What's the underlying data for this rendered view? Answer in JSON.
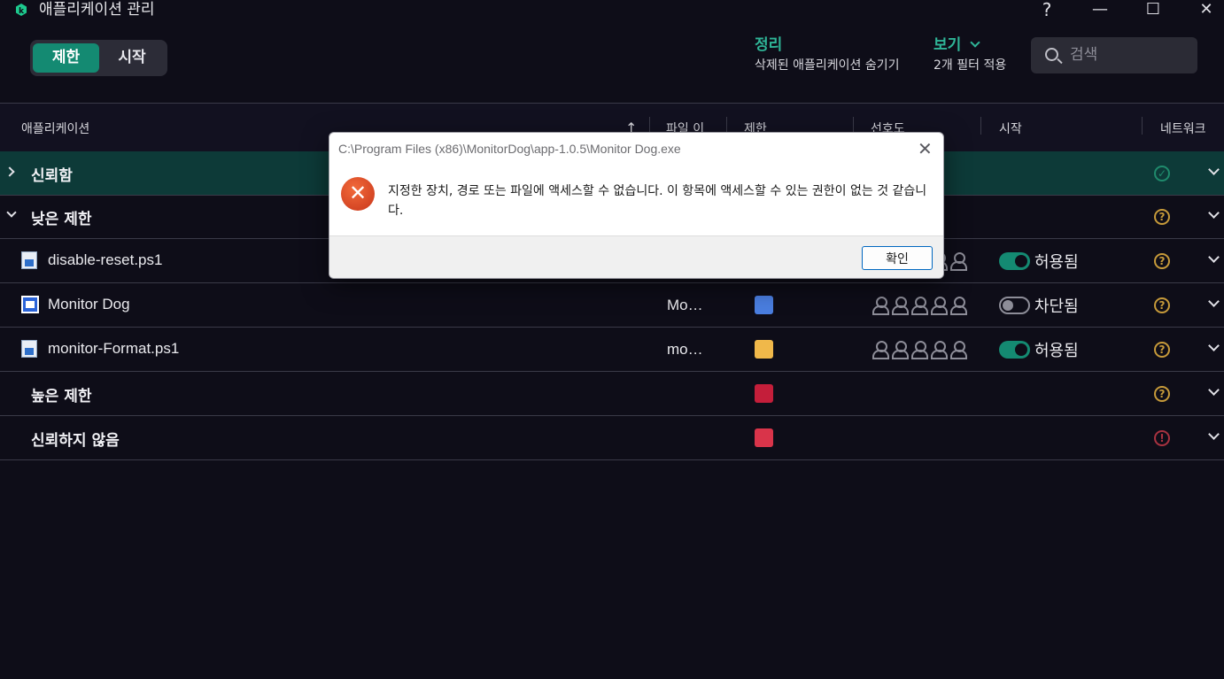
{
  "window": {
    "title": "애플리케이션 관리",
    "help_glyph": "?",
    "min_glyph": "—",
    "max_glyph": "☐",
    "close_glyph": "✕",
    "icon": "shield-k-icon"
  },
  "toolbar": {
    "segments": [
      {
        "label": "제한",
        "active": true
      },
      {
        "label": "시작",
        "active": false
      }
    ],
    "sort": {
      "label": "정리",
      "value": "삭제된 애플리케이션 숨기기"
    },
    "view": {
      "label": "보기",
      "value": "2개 필터 적용"
    },
    "search": {
      "placeholder": "검색",
      "value": ""
    }
  },
  "table": {
    "columns": [
      "애플리케이션",
      "파일 이",
      "제한",
      "선호도",
      "시작",
      "네트워크"
    ],
    "sort_arrow": "↑",
    "groups": [
      {
        "label": "신뢰함",
        "expanded": false,
        "network": "ok"
      },
      {
        "label": "낮은 제한",
        "expanded": true,
        "network": "question"
      }
    ],
    "apps": [
      {
        "name": "disable-reset.ps1",
        "file": "",
        "startup": "허용됨",
        "startup_on": true,
        "network": "question"
      },
      {
        "name": "Monitor Dog",
        "file": "Mo…",
        "restriction_color": "#4a7ee0",
        "startup": "차단됨",
        "startup_on": false,
        "network": "question"
      },
      {
        "name": "monitor-Format.ps1",
        "file": "mo…",
        "restriction_color": "#f0b84a",
        "startup": "허용됨",
        "startup_on": true,
        "network": "question"
      }
    ],
    "lower_groups": [
      {
        "label": "높은 제한",
        "restriction_color": "#c41e3a",
        "network": "question"
      },
      {
        "label": "신뢰하지 않음",
        "restriction_color": "#d9344a",
        "network": "warning"
      }
    ]
  },
  "dialog": {
    "title": "C:\\Program Files (x86)\\MonitorDog\\app-1.0.5\\Monitor Dog.exe",
    "close_glyph": "✕",
    "error_glyph": "✕",
    "message": "지정한 장치, 경로 또는 파일에 액세스할 수 없습니다. 이 항목에 액세스할 수 있는 권한이 없는 것 같습니다.",
    "ok_label": "확인"
  },
  "colors": {
    "accent": "#148a72",
    "background": "#0e0d18",
    "trusted_row": "#0d3a38"
  }
}
